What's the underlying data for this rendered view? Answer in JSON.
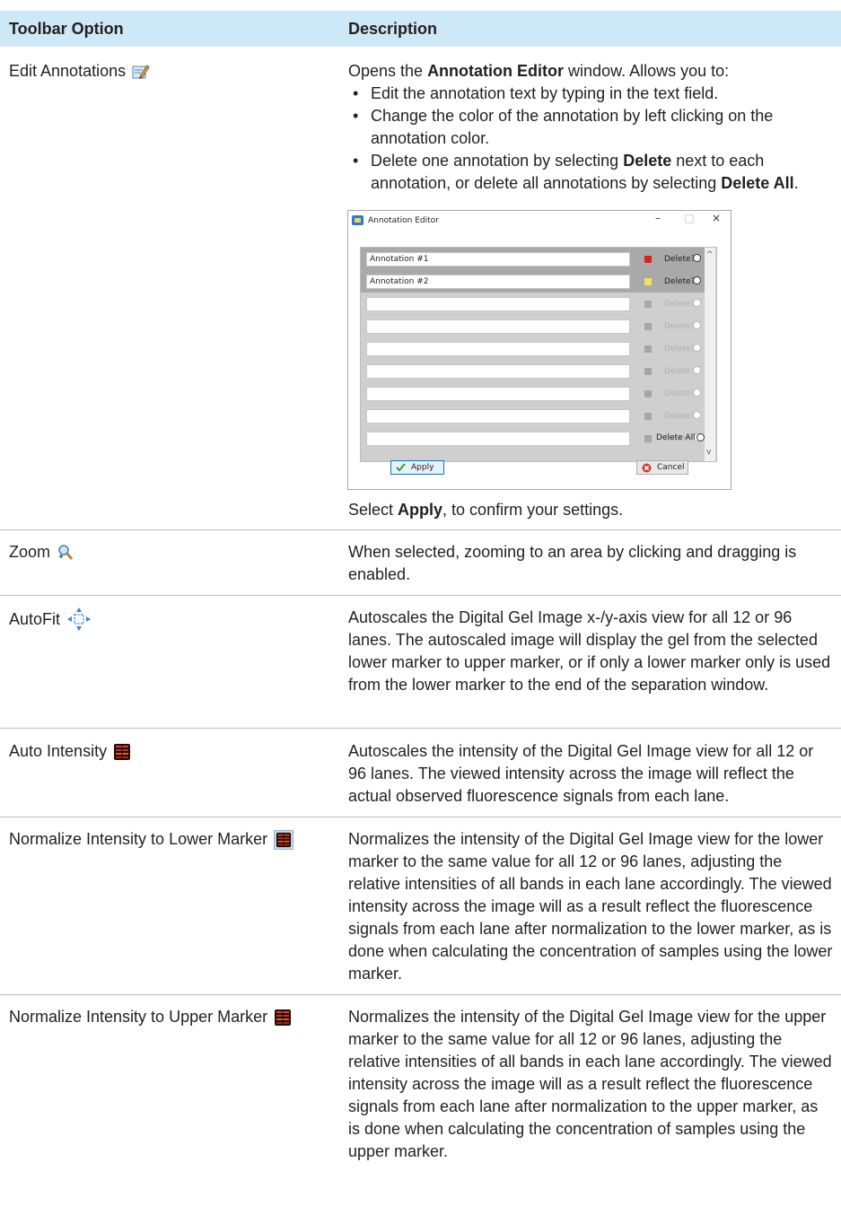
{
  "table": {
    "header": {
      "option": "Toolbar Option",
      "description": "Description"
    },
    "rows": [
      {
        "option": "Edit Annotations",
        "icon": "edit-annotations-icon",
        "desc_intro_pre": "Opens the ",
        "desc_intro_bold": "Annotation Editor",
        "desc_intro_post": " window. Allows you to:",
        "bullets": [
          {
            "text": "Edit the annotation text by typing in the text field."
          },
          {
            "text": "Change the color of the annotation by left clicking on the annotation color."
          },
          {
            "pre": "Delete one annotation by selecting ",
            "b1": "Delete",
            "mid": " next to each annotation, or delete all annotations by selecting ",
            "b2": "Delete All",
            "post": "."
          }
        ],
        "after_pre": "Select ",
        "after_bold": "Apply",
        "after_post": ", to confirm your settings."
      },
      {
        "option": "Zoom",
        "icon": "zoom-icon",
        "description": "When selected, zooming to an area by clicking and dragging is enabled."
      },
      {
        "option": "AutoFit",
        "icon": "autofit-icon",
        "description": "Autoscales the Digital Gel Image x-/y-axis view for all 12 or 96 lanes. The autoscaled image will display the gel from the selected lower marker to upper marker, or if only a lower marker only is used from the lower marker to the end of the separation window."
      },
      {
        "option": "Auto Intensity",
        "icon": "auto-intensity-icon",
        "description": "Autoscales the intensity of the Digital Gel Image view for all 12 or 96 lanes. The viewed intensity across the image will reflect the actual observed fluorescence signals from each lane."
      },
      {
        "option": "Normalize Intensity to Lower Marker",
        "icon": "normalize-lower-icon",
        "description": "Normalizes the intensity of the Digital Gel Image view for the lower marker to the same value for all 12 or 96 lanes, adjusting the relative intensities of all bands in each lane accordingly. The viewed intensity across the image will as a result reflect the fluorescence signals from each lane after normalization to the lower marker, as is done when calculating the concentration of samples using the lower marker."
      },
      {
        "option": "Normalize Intensity to Upper Marker",
        "icon": "normalize-upper-icon",
        "description": "Normalizes the intensity of the Digital Gel Image view for the upper marker to the same value for all 12 or 96 lanes, adjusting the relative intensities of all bands in each lane accordingly. The viewed intensity across the image will as a result reflect the fluorescence signals from each lane after normalization to the upper marker, as is done when calculating the concentration of samples using the upper marker."
      }
    ]
  },
  "dialog": {
    "title": "Annotation Editor",
    "minimize": "–",
    "maximize": "□",
    "close": "×",
    "annotations": [
      {
        "text": "Annotation #1",
        "color": "#e0201b"
      },
      {
        "text": "Annotation #2",
        "color": "#f6e05e"
      }
    ],
    "delete_label": "Delete?",
    "delete_all_label": "Delete All",
    "apply_label": "Apply",
    "cancel_label": "Cancel",
    "disabled_swatch": "#a6a6a6"
  },
  "colors": {
    "header_bg": "#cde8f6",
    "rule": "#bdbdbd"
  }
}
